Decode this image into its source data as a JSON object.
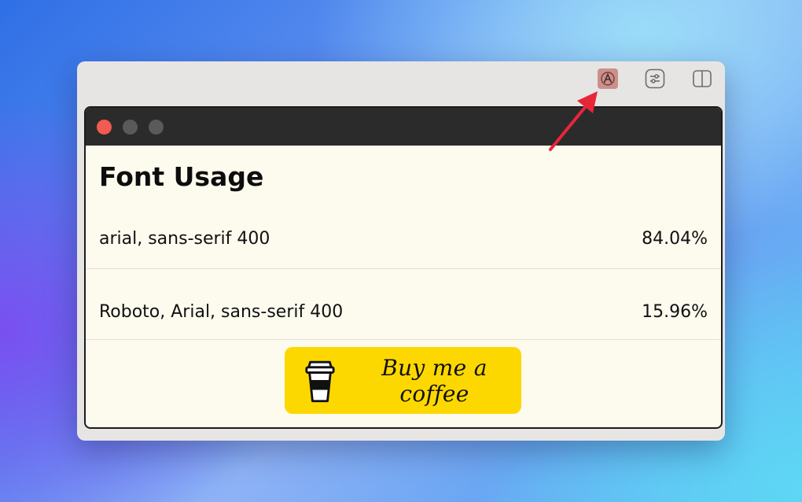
{
  "popup": {
    "heading": "Font Usage",
    "rows": [
      {
        "font": "arial, sans-serif 400",
        "percent": "84.04%"
      },
      {
        "font": "Roboto, Arial, sans-serif 400",
        "percent": "15.96%"
      }
    ],
    "coffee_label": "Buy me a coffee"
  },
  "colors": {
    "accent_yellow": "#fdd800",
    "titlebar": "#2b2b2b",
    "close_dot": "#f15b52",
    "arrow": "#e8263a",
    "panel_bg": "#fdfaee"
  },
  "icons": {
    "extension": "font-extension-icon",
    "adjust": "sliders-icon",
    "sidebar": "sidebar-icon",
    "coffee": "coffee-cup-icon"
  }
}
